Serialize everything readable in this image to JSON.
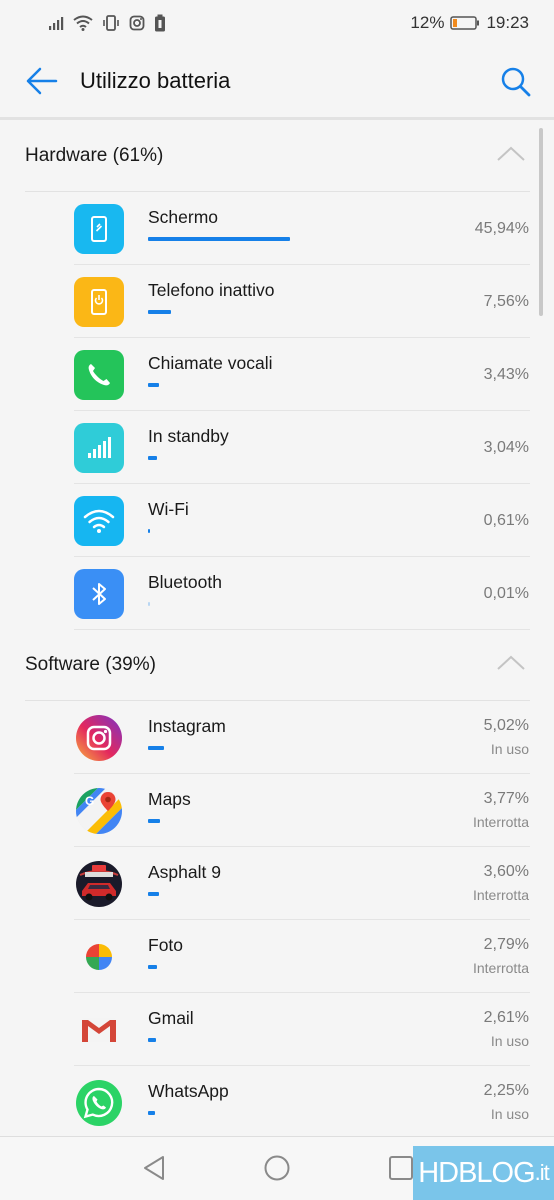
{
  "status_bar": {
    "battery": "12%",
    "time": "19:23"
  },
  "app_bar": {
    "title": "Utilizzo batteria"
  },
  "colors": {
    "accent": "#1680e8",
    "background": "#f5f5f5"
  },
  "hardware": {
    "title": "Hardware (61%)",
    "items": [
      {
        "name": "Schermo",
        "percent": "45,94%",
        "bar_fraction": 0.4594,
        "icon": "screen-icon"
      },
      {
        "name": "Telefono inattivo",
        "percent": "7,56%",
        "bar_fraction": 0.0756,
        "icon": "phone-idle-icon"
      },
      {
        "name": "Chiamate vocali",
        "percent": "3,43%",
        "bar_fraction": 0.0343,
        "icon": "phone-call-icon"
      },
      {
        "name": "In standby",
        "percent": "3,04%",
        "bar_fraction": 0.0304,
        "icon": "signal-icon"
      },
      {
        "name": "Wi-Fi",
        "percent": "0,61%",
        "bar_fraction": 0.0061,
        "icon": "wifi-icon"
      },
      {
        "name": "Bluetooth",
        "percent": "0,01%",
        "bar_fraction": 0.0001,
        "icon": "bluetooth-icon"
      }
    ]
  },
  "software": {
    "title": "Software (39%)",
    "items": [
      {
        "name": "Instagram",
        "percent": "5,02%",
        "status": "In uso",
        "bar_fraction": 0.0502,
        "icon": "instagram-icon"
      },
      {
        "name": "Maps",
        "percent": "3,77%",
        "status": "Interrotta",
        "bar_fraction": 0.0377,
        "icon": "maps-icon"
      },
      {
        "name": "Asphalt 9",
        "percent": "3,60%",
        "status": "Interrotta",
        "bar_fraction": 0.036,
        "icon": "asphalt-icon"
      },
      {
        "name": "Foto",
        "percent": "2,79%",
        "status": "Interrotta",
        "bar_fraction": 0.0279,
        "icon": "photos-icon"
      },
      {
        "name": "Gmail",
        "percent": "2,61%",
        "status": "In uso",
        "bar_fraction": 0.0261,
        "icon": "gmail-icon"
      },
      {
        "name": "WhatsApp",
        "percent": "2,25%",
        "status": "In uso",
        "bar_fraction": 0.0225,
        "icon": "whatsapp-icon"
      }
    ]
  },
  "watermark": {
    "brand": "HDBLOG",
    "suffix": ".it"
  }
}
